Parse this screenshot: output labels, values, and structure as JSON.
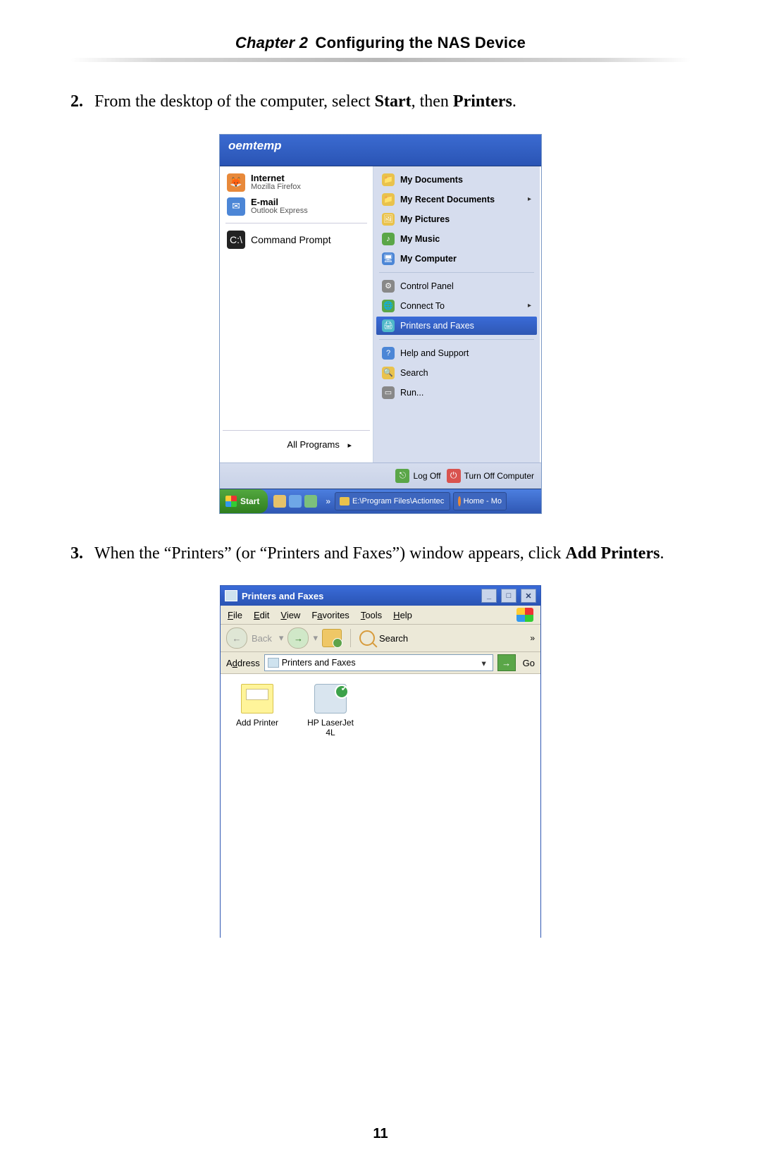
{
  "header": {
    "chapter_label": "Chapter 2",
    "chapter_title": "Configuring the NAS Device"
  },
  "steps": {
    "s2": {
      "num": "2.",
      "pre": "From the desktop of the computer, select ",
      "b1": "Start",
      "mid": ", then ",
      "b2": "Printers",
      "post": "."
    },
    "s3": {
      "num": "3.",
      "pre": "When the “Printers” (or “Printers and Faxes”) window appears, click ",
      "b1": "Add Printers",
      "post": "."
    }
  },
  "start_menu": {
    "user": "oemtemp",
    "left": {
      "internet": {
        "title": "Internet",
        "sub": "Mozilla Firefox"
      },
      "email": {
        "title": "E-mail",
        "sub": "Outlook Express"
      },
      "cmd": "Command Prompt",
      "all_programs": "All Programs"
    },
    "right": {
      "my_documents": "My Documents",
      "my_recent": "My Recent Documents",
      "my_pictures": "My Pictures",
      "my_music": "My Music",
      "my_computer": "My Computer",
      "control_panel": "Control Panel",
      "connect_to": "Connect To",
      "printers_faxes": "Printers and Faxes",
      "help_support": "Help and Support",
      "search": "Search",
      "run": "Run..."
    },
    "bottom": {
      "log_off": "Log Off",
      "turn_off": "Turn Off Computer"
    },
    "taskbar": {
      "start": "Start",
      "chevron": "»",
      "task1": "E:\\Program Files\\Actiontec",
      "task2": "Home - Mo"
    }
  },
  "printers_window": {
    "title": "Printers and Faxes",
    "menu": {
      "file": "File",
      "edit": "Edit",
      "view": "View",
      "favorites": "Favorites",
      "tools": "Tools",
      "help": "Help"
    },
    "toolbar": {
      "back": "Back",
      "search": "Search",
      "more": "»"
    },
    "address": {
      "label": "Address",
      "value": "Printers and Faxes",
      "go": "Go"
    },
    "items": {
      "add_printer": "Add Printer",
      "hp": "HP LaserJet 4L"
    }
  },
  "page_number": "11"
}
